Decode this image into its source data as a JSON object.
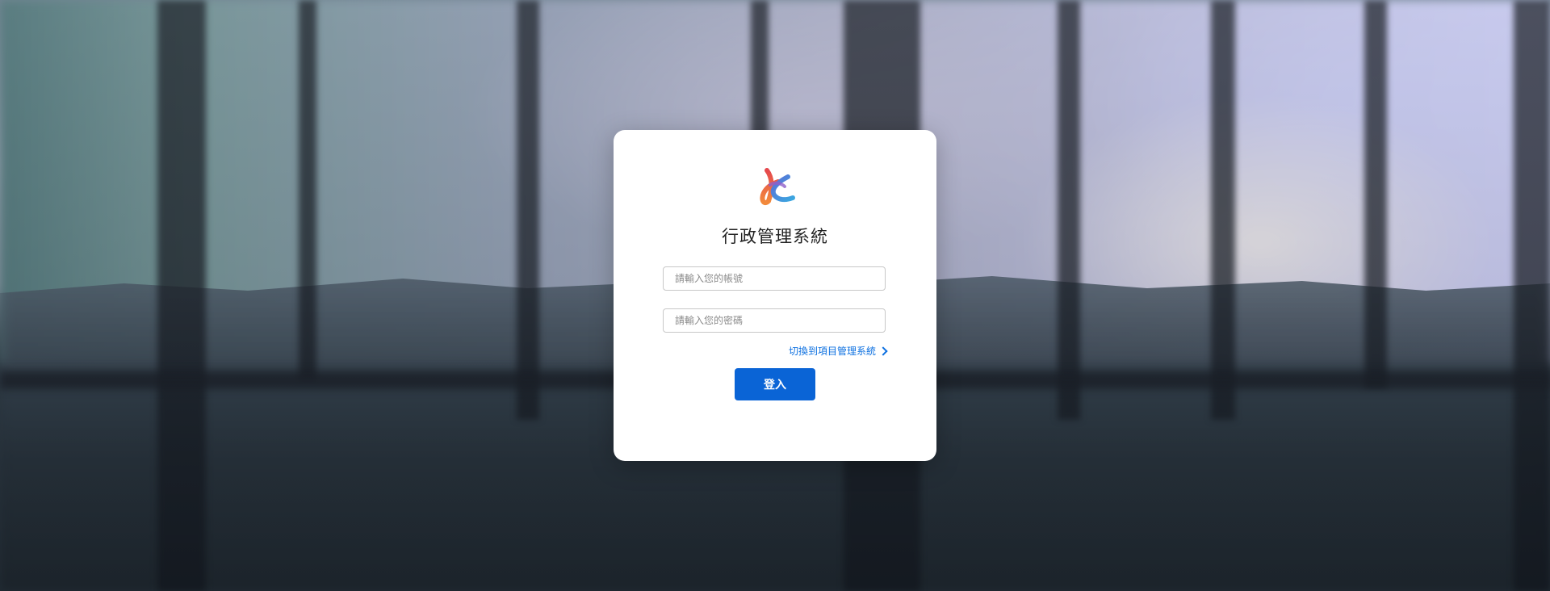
{
  "app": {
    "title": "行政管理系統"
  },
  "logo": {
    "icon": "brand-logo-icon",
    "colors": [
      "#e5484d",
      "#f28a3c",
      "#5b6fd6",
      "#3aa7e0"
    ]
  },
  "login": {
    "account_placeholder": "請輸入您的帳號",
    "account_value": "",
    "password_placeholder": "請輸入您的密碼",
    "password_value": "",
    "switch_link_label": "切換到項目管理系統",
    "switch_link_icon": "chevron-right-icon",
    "submit_label": "登入"
  },
  "colors": {
    "accent": "#0a64d6",
    "link": "#0b6fe0"
  }
}
